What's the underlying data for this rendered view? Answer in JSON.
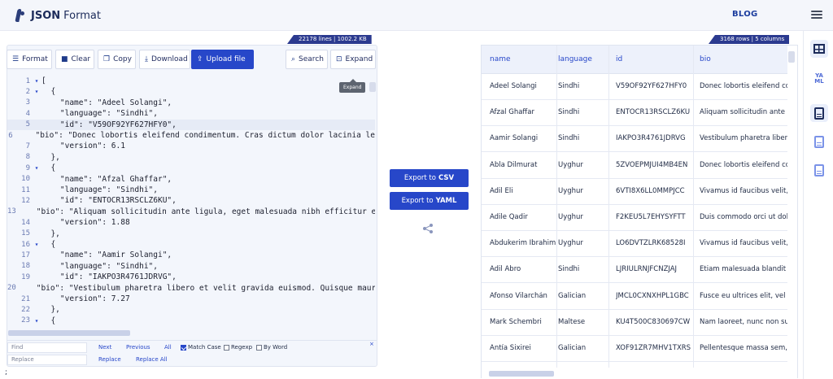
{
  "brand": {
    "strong": "JSON",
    "rest": "Format"
  },
  "nav": {
    "blog": "BLOG"
  },
  "left_panel": {
    "stats": "22178 lines | 1002.2 KB",
    "toolbar": {
      "format": "Format",
      "clear": "Clear",
      "copy": "Copy",
      "download": "Download",
      "upload": "Upload file",
      "search": "Search",
      "expand": "Expand"
    },
    "tooltip": "Expand",
    "lines": [
      {
        "n": "1",
        "fold": "▾",
        "text": "["
      },
      {
        "n": "2",
        "fold": "▾",
        "text": "  {"
      },
      {
        "n": "3",
        "fold": "",
        "text": "    \"name\": \"Adeel Solangi\","
      },
      {
        "n": "4",
        "fold": "",
        "text": "    \"language\": \"Sindhi\","
      },
      {
        "n": "5",
        "fold": "",
        "text": "    \"id\": \"V59OF92YF627HFY0\","
      },
      {
        "n": "6",
        "fold": "",
        "text": "    \"bio\": \"Donec lobortis eleifend condimentum. Cras dictum dolor lacinia le"
      },
      {
        "n": "7",
        "fold": "",
        "text": "    \"version\": 6.1"
      },
      {
        "n": "8",
        "fold": "",
        "text": "  },"
      },
      {
        "n": "9",
        "fold": "▾",
        "text": "  {"
      },
      {
        "n": "10",
        "fold": "",
        "text": "    \"name\": \"Afzal Ghaffar\","
      },
      {
        "n": "11",
        "fold": "",
        "text": "    \"language\": \"Sindhi\","
      },
      {
        "n": "12",
        "fold": "",
        "text": "    \"id\": \"ENTOCR13RSCLZ6KU\","
      },
      {
        "n": "13",
        "fold": "",
        "text": "    \"bio\": \"Aliquam sollicitudin ante ligula, eget malesuada nibh efficitur e"
      },
      {
        "n": "14",
        "fold": "",
        "text": "    \"version\": 1.88"
      },
      {
        "n": "15",
        "fold": "",
        "text": "  },"
      },
      {
        "n": "16",
        "fold": "▾",
        "text": "  {"
      },
      {
        "n": "17",
        "fold": "",
        "text": "    \"name\": \"Aamir Solangi\","
      },
      {
        "n": "18",
        "fold": "",
        "text": "    \"language\": \"Sindhi\","
      },
      {
        "n": "19",
        "fold": "",
        "text": "    \"id\": \"IAKPO3R4761JDRVG\","
      },
      {
        "n": "20",
        "fold": "",
        "text": "    \"bio\": \"Vestibulum pharetra libero et velit gravida euismod. Quisque maur"
      },
      {
        "n": "21",
        "fold": "",
        "text": "    \"version\": 7.27"
      },
      {
        "n": "22",
        "fold": "",
        "text": "  },"
      },
      {
        "n": "23",
        "fold": "▾",
        "text": "  {"
      }
    ],
    "find": {
      "find_placeholder": "Find",
      "replace_placeholder": "Replace",
      "next": "Next",
      "previous": "Previous",
      "all": "All",
      "match_case": "Match Case",
      "regexp": "Regexp",
      "by_word": "By Word",
      "replace": "Replace",
      "replace_all": "Replace All",
      "close": "×"
    }
  },
  "middle": {
    "export_csv_prefix": "Export to",
    "export_csv_fmt": "CSV",
    "export_yaml_prefix": "Export to",
    "export_yaml_fmt": "YAML"
  },
  "right_panel": {
    "stats": "3168 rows | 5 columns",
    "columns": [
      "name",
      "language",
      "id",
      "bio"
    ],
    "rows": [
      [
        "Adeel Solangi",
        "Sindhi",
        "V59OF92YF627HFY0",
        "Donec lobortis eleifend cor"
      ],
      [
        "Afzal Ghaffar",
        "Sindhi",
        "ENTOCR13RSCLZ6KU",
        "Aliquam sollicitudin ante lig"
      ],
      [
        "Aamir Solangi",
        "Sindhi",
        "IAKPO3R4761JDRVG",
        "Vestibulum pharetra libero"
      ],
      [
        "Abla Dilmurat",
        "Uyghur",
        "5ZVOEPMJUI4MB4EN",
        "Donec lobortis eleifend cor"
      ],
      [
        "Adil Eli",
        "Uyghur",
        "6VTI8X6LL0MMPJCC",
        "Vivamus id faucibus velit, ic"
      ],
      [
        "Adile Qadir",
        "Uyghur",
        "F2KEU5L7EHYSYFTT",
        "Duis commodo orci ut dolo"
      ],
      [
        "Abdukerim Ibrahim",
        "Uyghur",
        "LO6DVTZLRK68528I",
        "Vivamus id faucibus velit, ic"
      ],
      [
        "Adil Abro",
        "Sindhi",
        "LJRIULRNJFCNZJAJ",
        "Etiam malesuada blandit er"
      ],
      [
        "Afonso Vilarchán",
        "Galician",
        "JMCL0CXNXHPL1GBC",
        "Fusce eu ultrices elit, vel pc"
      ],
      [
        "Mark Schembri",
        "Maltese",
        "KU4T500C830697CW",
        "Nam laoreet, nunc non sus"
      ],
      [
        "Antía Sixirei",
        "Galician",
        "XOF91ZR7MHV1TXRS",
        "Pellentesque massa sem, s"
      ]
    ]
  },
  "sidebar_icons": [
    "table-icon",
    "yaml-icon",
    "document-icon",
    "document-light-icon",
    "document-light-icon"
  ],
  "sidebar_yaml_text": "YA ML",
  "footer_char": ";",
  "colors": {
    "primary": "#2747c9",
    "badge": "#2b3a8f",
    "header_bg": "#f4f6fb"
  }
}
